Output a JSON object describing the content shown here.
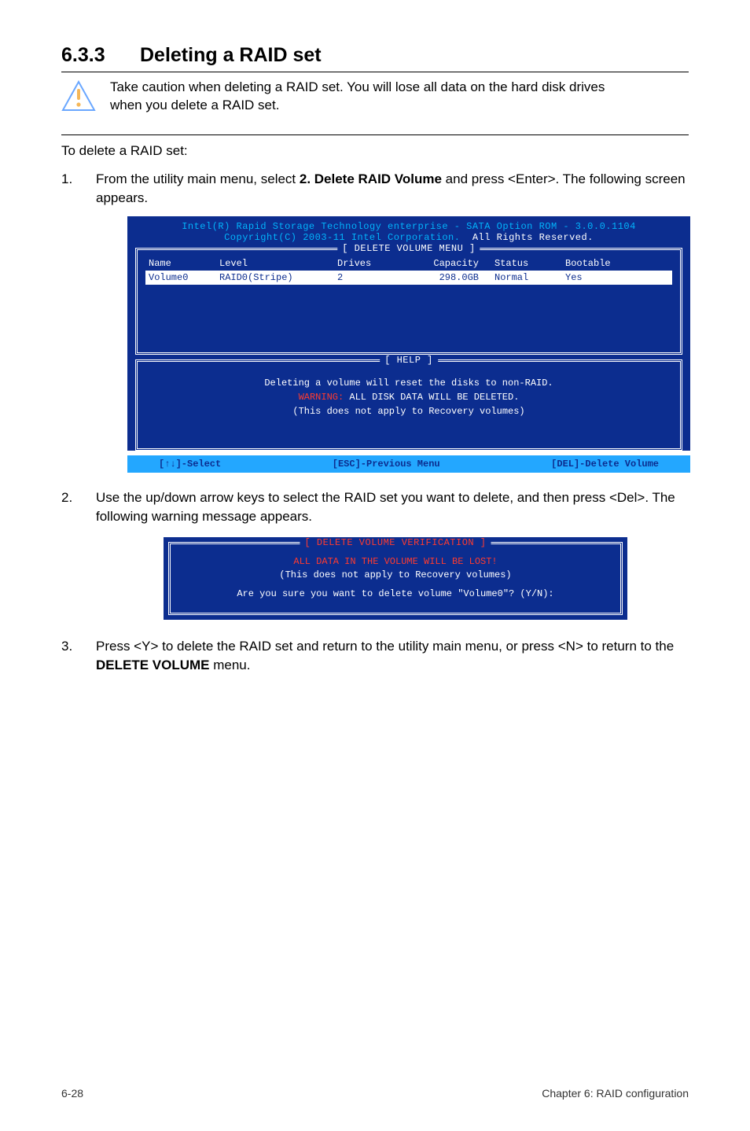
{
  "heading": {
    "number": "6.3.3",
    "title": "Deleting a RAID set"
  },
  "note": "Take caution when deleting a RAID set. You will lose all data on the hard disk drives when you delete a RAID set.",
  "intro": "To delete a RAID set:",
  "steps": {
    "s1_num": "1.",
    "s1_text_a": "From the utility main menu, select ",
    "s1_bold": "2. Delete RAID Volume",
    "s1_text_b": " and press <Enter>. The following screen appears.",
    "s2_num": "2.",
    "s2_text": "Use the up/down arrow keys to select the RAID set you want to delete, and then press <Del>. The following warning message appears.",
    "s3_num": "3.",
    "s3_text_a": "Press <Y> to delete the RAID set and return to the utility main menu, or press <N> to return to the ",
    "s3_bold": "DELETE VOLUME",
    "s3_text_b": " menu."
  },
  "bios": {
    "title_line1": "Intel(R) Rapid Storage Technology enterprise - SATA Option ROM - 3.0.0.1104",
    "title_line2_left": "Copyright(C) 2003-11 Intel Corporation.",
    "title_line2_right": "All Rights Reserved.",
    "delete_menu_label": "[ DELETE VOLUME MENU ]",
    "columns": {
      "name": "Name",
      "level": "Level",
      "drives": "Drives",
      "capacity": "Capacity",
      "status": "Status",
      "bootable": "Bootable"
    },
    "row": {
      "name": "Volume0",
      "level": "RAID0(Stripe)",
      "drives": "2",
      "capacity": "298.0GB",
      "status": "Normal",
      "bootable": "Yes"
    },
    "help_label": "[ HELP ]",
    "help_l1": "Deleting a volume will reset the disks to non-RAID.",
    "help_l2_warn": "WARNING:",
    "help_l2_rest": " ALL DISK DATA WILL BE DELETED.",
    "help_l3": "(This does not apply to Recovery volumes)",
    "footer_left": "[↑↓]-Select",
    "footer_mid": "[ESC]-Previous Menu",
    "footer_right": "[DEL]-Delete Volume"
  },
  "dialog": {
    "label": "[ DELETE VOLUME VERIFICATION ]",
    "l1": "ALL DATA IN THE VOLUME WILL BE LOST!",
    "l2": "(This does not apply to Recovery volumes)",
    "l3": "Are you sure you want to delete volume \"Volume0\"? (Y/N):"
  },
  "footer": {
    "left": "6-28",
    "right": "Chapter 6: RAID configuration"
  }
}
